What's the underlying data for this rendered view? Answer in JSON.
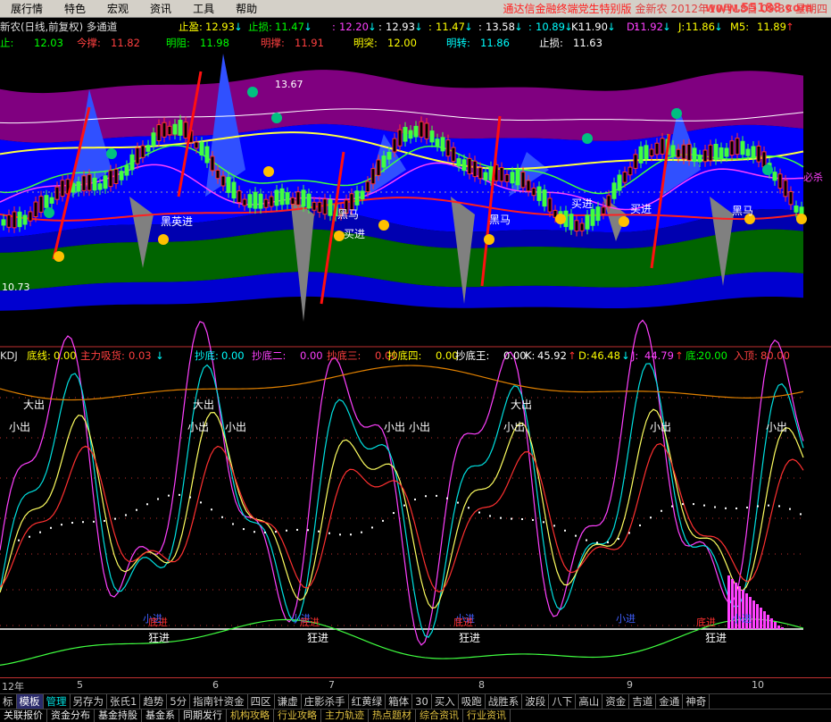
{
  "menu": {
    "items": [
      "展行情",
      "特色",
      "宏观",
      "资讯",
      "工具",
      "帮助"
    ],
    "title": "通达信金融终端党生特别版",
    "stock_name": "金新农",
    "datetime": "2012年10月18日 09:39",
    "weekday": "星期四",
    "watermark": "www.55188.com"
  },
  "price_info": {
    "chart_title": "新农(日线,前复权) 多通道",
    "items": [
      {
        "label": "止盈:",
        "value": "12.93",
        "arrow": "↓",
        "color": "#ffff00"
      },
      {
        "label": "止损:",
        "value": "11.47",
        "arrow": "↓",
        "color": "#00ff00"
      },
      {
        "label": ":",
        "value": "12.20",
        "arrow": "↓",
        "color": "#ff40ff"
      },
      {
        "label": ":",
        "value": "12.93",
        "arrow": "↓",
        "color": "#ffffff"
      },
      {
        "label": ":",
        "value": "11.47",
        "arrow": "↓",
        "color": "#ffff00"
      },
      {
        "label": ":",
        "value": "13.58",
        "arrow": "↓",
        "color": "#ffffff"
      },
      {
        "label": ":",
        "value": "10.89",
        "arrow": "↓",
        "color": "#00ffff"
      },
      {
        "label": "K:",
        "value": "11.90",
        "arrow": "↓",
        "color": "#ffffff"
      },
      {
        "label": "D:",
        "value": "11.92",
        "arrow": "↓",
        "color": "#ff40ff"
      },
      {
        "label": "J:",
        "value": "11.86",
        "arrow": "↓",
        "color": "#ffff00"
      },
      {
        "label": "M5:",
        "value": "11.89",
        "arrow": "↑",
        "color": "#ffff00"
      }
    ],
    "row2": [
      {
        "label": "止:",
        "value": "12.03",
        "color": "#00ff00"
      },
      {
        "label": "今撑:",
        "value": "11.82",
        "color": "#ff4040"
      },
      {
        "label": "明阻:",
        "value": "11.98",
        "color": "#00ff00"
      },
      {
        "label": "明撑:",
        "value": "11.91",
        "color": "#ff4040"
      },
      {
        "label": "明突:",
        "value": "12.00",
        "color": "#ffff00"
      },
      {
        "label": "明转:",
        "value": "11.86",
        "color": "#00ffff"
      },
      {
        "label": "止损:",
        "value": "11.63",
        "color": "#ffffff"
      }
    ]
  },
  "main_chart": {
    "high_label": "13.67",
    "low_label": "10.73",
    "side_label": "必杀",
    "signals": [
      "黑英进",
      "黑马",
      "买进",
      "黑马",
      "买进",
      "买进",
      "黑马"
    ]
  },
  "indicator": {
    "title": "KDJ",
    "items": [
      {
        "label": "底线:",
        "value": "0.00",
        "color": "#ffff00"
      },
      {
        "label": "主力吸货:",
        "value": "0.03",
        "arrow": "↓",
        "color": "#ff4040"
      },
      {
        "label": "抄底:",
        "value": "0.00",
        "color": "#00ffff"
      },
      {
        "label": "抄底二:",
        "value": "0.00",
        "color": "#ff40ff"
      },
      {
        "label": "抄底三:",
        "value": "0.00",
        "color": "#ff4040"
      },
      {
        "label": "抄底四:",
        "value": "0.00",
        "color": "#ffff00"
      },
      {
        "label": "抄底王:",
        "value": "0.00",
        "color": "#ffffff"
      },
      {
        "label": "K:",
        "value": "45.92",
        "arrow": "↑",
        "color": "#ffffff"
      },
      {
        "label": "D:",
        "value": "46.48",
        "arrow": "↓",
        "color": "#ffff00"
      },
      {
        "label": "J:",
        "value": "44.79",
        "arrow": "↑",
        "color": "#ff40ff"
      },
      {
        "label": "底:",
        "value": "20.00",
        "color": "#00ff00"
      },
      {
        "label": "入顶:",
        "value": "80.00",
        "color": "#ff4040"
      }
    ],
    "signals": {
      "big_out": "大出",
      "small_out": "小出",
      "small_in": "小进",
      "crazy_in": "狂进",
      "bottom_in": "底进"
    }
  },
  "date_axis": [
    "12年",
    "5",
    "6",
    "7",
    "8",
    "9",
    "10"
  ],
  "tabs_row1": [
    "标",
    "模板",
    "管理",
    "另存为",
    "张氏1",
    "趋势",
    "5分",
    "指南针资金",
    "四区",
    "谦虚",
    "庄影杀手",
    "红黄绿",
    "箱体",
    "30",
    "买入",
    "吸跑",
    "战胜系",
    "波段",
    "八下",
    "高山",
    "资金",
    "吉道",
    "金通",
    "神奇"
  ],
  "tabs_row2": [
    "关联报价",
    "资金分布",
    "基金持股",
    "基金系",
    "同期发行",
    "机构攻略",
    "行业攻略",
    "主力轨迹",
    "热点题材",
    "综合资讯",
    "行业资讯"
  ],
  "colors": {
    "bg": "#000000",
    "purple_band": "#800080",
    "blue_band": "#0000ff",
    "green_band": "#006400",
    "grey_bars": "#808080"
  }
}
